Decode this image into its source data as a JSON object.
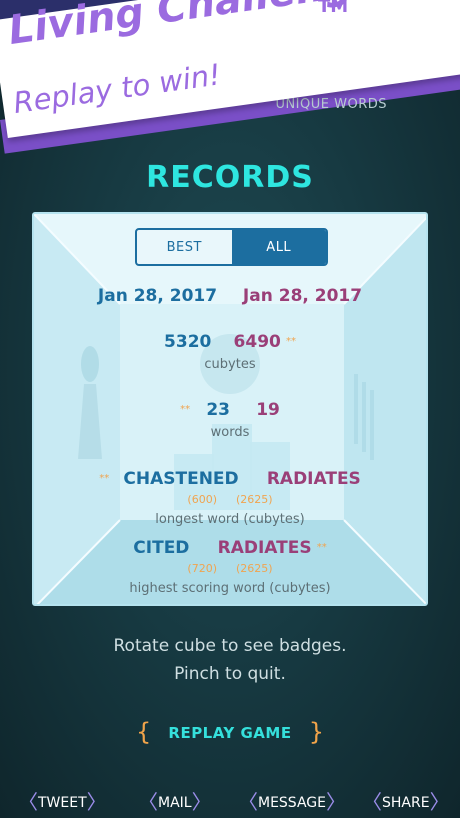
{
  "promo": {
    "title": "Living Challenge",
    "trademark": "TM",
    "subtitle": "Replay to win!"
  },
  "header": {
    "unique_words": "UNIQUE WORDS"
  },
  "records": {
    "title": "RECORDS",
    "tabs": [
      {
        "label": "BEST",
        "selected": false
      },
      {
        "label": "ALL",
        "selected": true
      }
    ],
    "date_left": "Jan 28, 2017",
    "date_right": "Jan 28, 2017",
    "cubytes_left": "5320",
    "cubytes_right": "6490",
    "cubytes_label": "cubytes",
    "words_left": "23",
    "words_right": "19",
    "words_label": "words",
    "longest_left": "CHASTENED",
    "longest_right": "RADIATES",
    "longest_left_score": "(600)",
    "longest_right_score": "(2625)",
    "longest_label": "longest word (cubytes)",
    "highest_left": "CITED",
    "highest_right": "RADIATES",
    "highest_left_score": "(720)",
    "highest_right_score": "(2625)",
    "highest_label": "highest scoring word (cubytes)",
    "star_marker": "**"
  },
  "hint": {
    "line1": "Rotate cube to see badges.",
    "line2": "Pinch to quit."
  },
  "replay": {
    "left_brace": "{",
    "label": "REPLAY GAME",
    "right_brace": "}"
  },
  "share": [
    {
      "label": "TWEET",
      "icon": "tweet-icon"
    },
    {
      "label": "MAIL",
      "icon": "mail-icon"
    },
    {
      "label": "MESSAGE",
      "icon": "message-icon"
    },
    {
      "label": "SHARE",
      "icon": "share-icon"
    }
  ],
  "colors": {
    "accent_cyan": "#2ee6e0",
    "player_blue": "#1c6ea0",
    "opponent_purple": "#9a3f78",
    "score_orange": "#f0a450",
    "promo_purple": "#9b6be0"
  }
}
